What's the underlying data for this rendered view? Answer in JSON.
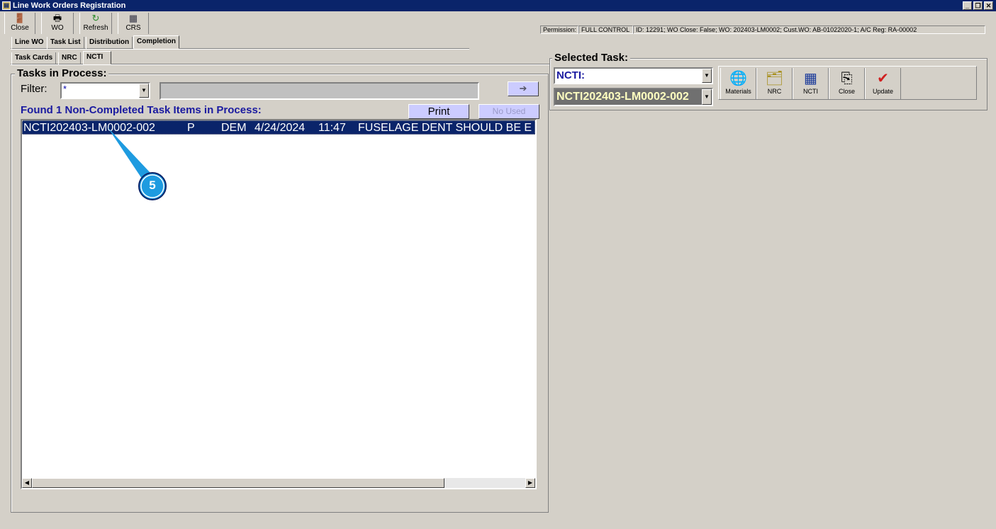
{
  "window": {
    "title": "Line Work Orders Registration",
    "app_icon": "LT"
  },
  "toolbar": [
    {
      "label": "Close",
      "icon": "door-exit-icon"
    },
    {
      "label": "WO",
      "icon": "printer-icon"
    },
    {
      "label": "Refresh",
      "icon": "refresh-icon"
    },
    {
      "label": "CRS",
      "icon": "form-edit-icon"
    }
  ],
  "status": {
    "permission_label": "Permission:",
    "permission_value": "FULL CONTROL",
    "info": "ID: 12291; WO Close: False; WO: 202403-LM0002; Cust.WO: AB-01022020-1; A/C Reg: RA-00002"
  },
  "tabs": [
    "Line WO",
    "Task List",
    "Distribution",
    "Completion"
  ],
  "subtabs": [
    "Task Cards",
    "NRC",
    "NCTI"
  ],
  "tasks": {
    "title": "Tasks in Process:",
    "filter_label": "Filter:",
    "filter_value": "*",
    "found_text": "Found 1 Non-Completed Task Items in Process:",
    "print": "Print",
    "no_used": "No Used",
    "go_icon": "arrow-right-icon",
    "rows": [
      {
        "id": "NCTI202403-LM0002-002",
        "status": "P",
        "dept": "DEM",
        "date": "4/24/2024",
        "time": "11:47",
        "desc": "FUSELAGE DENT SHOULD BE E"
      }
    ]
  },
  "selected": {
    "title": "Selected Task:",
    "type_value": "NCTI:",
    "task_value": "NCTI202403-LM0002-002",
    "buttons": [
      {
        "label": "Materials",
        "icon": "materials-globe-icon"
      },
      {
        "label": "NRC",
        "icon": "folder-docs-icon"
      },
      {
        "label": "NCTI",
        "icon": "ncti-grid-icon"
      },
      {
        "label": "Close",
        "icon": "close-task-icon"
      },
      {
        "label": "Update",
        "icon": "clipboard-check-icon"
      }
    ]
  },
  "annotation": {
    "marker": "5",
    "color": "#1e9be0"
  }
}
